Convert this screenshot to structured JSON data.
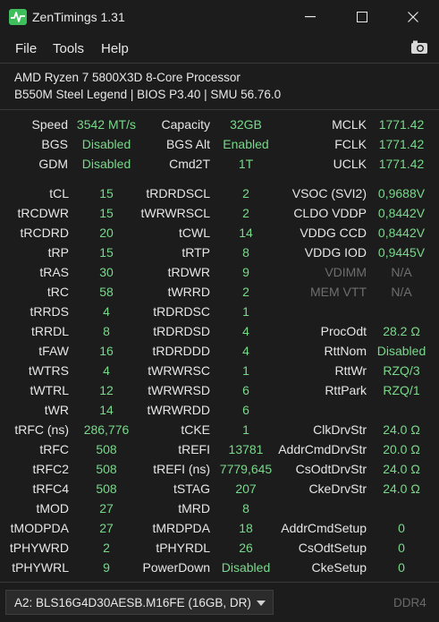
{
  "window": {
    "title": "ZenTimings 1.31",
    "minimize": "–",
    "maximize": "☐",
    "close": "✕"
  },
  "menu": {
    "items": [
      "File",
      "Tools",
      "Help"
    ]
  },
  "cpu": {
    "name": "AMD Ryzen 7 5800X3D 8-Core Processor",
    "board": "B550M Steel Legend | BIOS P3.40 | SMU 56.76.0"
  },
  "top": {
    "col1": [
      {
        "label": "Speed",
        "value": "3542 MT/s"
      },
      {
        "label": "BGS",
        "value": "Disabled"
      },
      {
        "label": "GDM",
        "value": "Disabled"
      }
    ],
    "col2": [
      {
        "label": "Capacity",
        "value": "32GB"
      },
      {
        "label": "BGS Alt",
        "value": "Enabled"
      },
      {
        "label": "Cmd2T",
        "value": "1T"
      }
    ],
    "col3": [
      {
        "label": "MCLK",
        "value": "1771.42"
      },
      {
        "label": "FCLK",
        "value": "1771.42"
      },
      {
        "label": "UCLK",
        "value": "1771.42"
      }
    ]
  },
  "timings": {
    "col1": [
      {
        "label": "tCL",
        "value": "15"
      },
      {
        "label": "tRCDWR",
        "value": "15"
      },
      {
        "label": "tRCDRD",
        "value": "20"
      },
      {
        "label": "tRP",
        "value": "15"
      },
      {
        "label": "tRAS",
        "value": "30"
      },
      {
        "label": "tRC",
        "value": "58"
      },
      {
        "label": "tRRDS",
        "value": "4"
      },
      {
        "label": "tRRDL",
        "value": "8"
      },
      {
        "label": "tFAW",
        "value": "16"
      },
      {
        "label": "tWTRS",
        "value": "4"
      },
      {
        "label": "tWTRL",
        "value": "12"
      },
      {
        "label": "tWR",
        "value": "14"
      },
      {
        "label": "tRFC (ns)",
        "value": "286,776"
      },
      {
        "label": "tRFC",
        "value": "508"
      },
      {
        "label": "tRFC2",
        "value": "508"
      },
      {
        "label": "tRFC4",
        "value": "508"
      },
      {
        "label": "tMOD",
        "value": "27"
      },
      {
        "label": "tMODPDA",
        "value": "27"
      },
      {
        "label": "tPHYWRD",
        "value": "2"
      },
      {
        "label": "tPHYWRL",
        "value": "9"
      }
    ],
    "col2": [
      {
        "label": "tRDRDSCL",
        "value": "2"
      },
      {
        "label": "tWRWRSCL",
        "value": "2"
      },
      {
        "label": "tCWL",
        "value": "14"
      },
      {
        "label": "tRTP",
        "value": "8"
      },
      {
        "label": "tRDWR",
        "value": "9"
      },
      {
        "label": "tWRRD",
        "value": "2"
      },
      {
        "label": "tRDRDSC",
        "value": "1"
      },
      {
        "label": "tRDRDSD",
        "value": "4"
      },
      {
        "label": "tRDRDDD",
        "value": "4"
      },
      {
        "label": "tWRWRSC",
        "value": "1"
      },
      {
        "label": "tWRWRSD",
        "value": "6"
      },
      {
        "label": "tWRWRDD",
        "value": "6"
      },
      {
        "label": "tCKE",
        "value": "1"
      },
      {
        "label": "tREFI",
        "value": "13781"
      },
      {
        "label": "tREFI (ns)",
        "value": "7779,645"
      },
      {
        "label": "tSTAG",
        "value": "207"
      },
      {
        "label": "tMRD",
        "value": "8"
      },
      {
        "label": "tMRDPDA",
        "value": "18"
      },
      {
        "label": "tPHYRDL",
        "value": "26"
      },
      {
        "label": "PowerDown",
        "value": "Disabled"
      }
    ],
    "col3": [
      {
        "label": "VSOC (SVI2)",
        "value": "0,9688V",
        "row": 0
      },
      {
        "label": "CLDO VDDP",
        "value": "0,8442V",
        "row": 1
      },
      {
        "label": "VDDG CCD",
        "value": "0,8442V",
        "row": 2
      },
      {
        "label": "VDDG IOD",
        "value": "0,9445V",
        "row": 3
      },
      {
        "label": "VDIMM",
        "value": "N/A",
        "row": 4,
        "dim": true
      },
      {
        "label": "MEM VTT",
        "value": "N/A",
        "row": 5,
        "dim": true
      },
      {
        "label": "ProcOdt",
        "value": "28.2 Ω",
        "row": 7
      },
      {
        "label": "RttNom",
        "value": "Disabled",
        "row": 8
      },
      {
        "label": "RttWr",
        "value": "RZQ/3",
        "row": 9
      },
      {
        "label": "RttPark",
        "value": "RZQ/1",
        "row": 10
      },
      {
        "label": "ClkDrvStr",
        "value": "24.0 Ω",
        "row": 12
      },
      {
        "label": "AddrCmdDrvStr",
        "value": "20.0 Ω",
        "row": 13
      },
      {
        "label": "CsOdtDrvStr",
        "value": "24.0 Ω",
        "row": 14
      },
      {
        "label": "CkeDrvStr",
        "value": "24.0 Ω",
        "row": 15
      },
      {
        "label": "AddrCmdSetup",
        "value": "0",
        "row": 17
      },
      {
        "label": "CsOdtSetup",
        "value": "0",
        "row": 18
      },
      {
        "label": "CkeSetup",
        "value": "0",
        "row": 19
      }
    ]
  },
  "footer": {
    "module": "A2: BLS16G4D30AESB.M16FE (16GB, DR)",
    "mem_type": "DDR4"
  },
  "colors": {
    "value": "#79d98b",
    "dim": "#6e6e6e",
    "background": "#1c1c1c"
  }
}
